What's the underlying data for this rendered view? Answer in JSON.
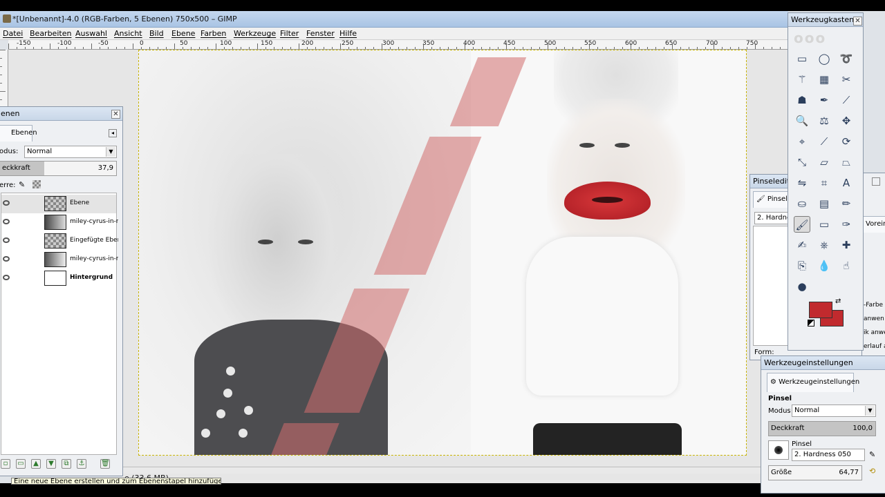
{
  "window_title": "*[Unbenannt]-4.0 (RGB-Farben, 5 Ebenen) 750x500 – GIMP",
  "menu": [
    "Datei",
    "Bearbeiten",
    "Auswahl",
    "Ansicht",
    "Bild",
    "Ebene",
    "Farben",
    "Werkzeuge",
    "Filter",
    "Fenster",
    "Hilfe"
  ],
  "ruler_labels": [
    "-150",
    "-100",
    "-50",
    "0",
    "50",
    "100",
    "150",
    "200",
    "250",
    "300",
    "350",
    "400",
    "450",
    "500",
    "550",
    "600",
    "650",
    "700",
    "750"
  ],
  "status_text": "e (33,6 MB)",
  "tooltip": "Eine neue Ebene erstellen und zum Ebenenstapel hinzufügen",
  "layers_panel": {
    "title": "enen",
    "tab_label": "Ebenen",
    "mode_label": "odus:",
    "mode_value": "Normal",
    "opacity_label": "eckkraft",
    "opacity_value": "37,9",
    "opacity_fraction": 0.379,
    "lock_label": "erre:",
    "layers": [
      {
        "name": "Ebene",
        "selected": true,
        "bold": false
      },
      {
        "name": "miley-cyrus-in-ne",
        "selected": false,
        "bold": false
      },
      {
        "name": "Eingefügte Ebene",
        "selected": false,
        "bold": false
      },
      {
        "name": "miley-cyrus-in-ne",
        "selected": false,
        "bold": false
      },
      {
        "name": "Hintergrund",
        "selected": false,
        "bold": true
      }
    ]
  },
  "toolbox": {
    "title": "Werkzeugkasten",
    "fg_color": "#c12a2e",
    "bg_color": "#c12a2e"
  },
  "brush_editor": {
    "title": "Pinseledito",
    "tab_label": "Pinsel",
    "brush_name": "2. Hardnes",
    "form_label": "Form:"
  },
  "right_partial": {
    "tab_label": "Vorein",
    "lines": [
      "-Farbe a",
      "anwen",
      "ik anwe",
      "erlauf a"
    ]
  },
  "tool_options": {
    "title": "Werkzeugeinstellungen",
    "tab_label": "Werkzeugeinstellungen",
    "tool_name": "Pinsel",
    "mode_label": "Modus",
    "mode_value": "Normal",
    "opacity_label": "Deckkraft",
    "opacity_value": "100,0",
    "opacity_fraction": 1.0,
    "brush_label": "Pinsel",
    "brush_value": "2. Hardness 050",
    "size_label": "Größe",
    "size_value": "64,77"
  }
}
